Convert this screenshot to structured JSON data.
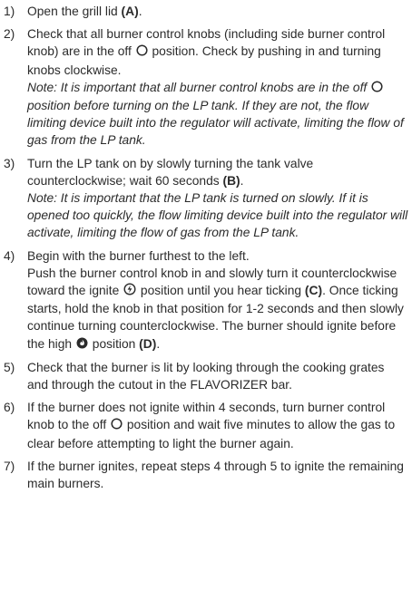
{
  "steps": [
    {
      "num": "1)",
      "text": "Open the grill lid ",
      "ref": "(A)",
      "tail": "."
    },
    {
      "num": "2)",
      "text_a": "Check that all burner control knobs (including side burner control knob) are in the off ",
      "text_b": " position. Check by pushing in and turning knobs clockwise.",
      "note_a": "Note: It is important that all burner control knobs are in the off ",
      "note_b": " position before turning on the LP tank. If they are not, the flow limiting device built into the regulator will activate, limiting the flow of gas from the LP tank."
    },
    {
      "num": "3)",
      "text": "Turn the LP tank on by slowly turning the tank valve counterclockwise; wait 60 seconds ",
      "ref": "(B)",
      "tail": ".",
      "note": "Note: It is important that the LP tank is turned on slowly. If it is opened too quickly, the flow limiting device built into the regulator will activate, limiting the flow of gas from the LP tank."
    },
    {
      "num": "4)",
      "line1": "Begin with the burner furthest to the left.",
      "text_a": "Push the burner control knob in and slowly turn it counterclockwise toward the ignite ",
      "text_b": " position until you hear ticking ",
      "ref_c": "(C)",
      "text_c": ". Once ticking starts, hold the knob in that position for 1-2 seconds and then slowly continue turning counterclockwise. The burner should ignite before the high ",
      "text_d": " position ",
      "ref_d": "(D)",
      "tail": "."
    },
    {
      "num": "5)",
      "text": "Check that the burner is lit by looking through the cooking grates and through the cutout in the FLAVORIZER bar."
    },
    {
      "num": "6)",
      "text_a": "If the burner does not ignite within 4 seconds, turn burner control knob to the off ",
      "text_b": " position and wait five minutes to allow the gas to clear before attempting to light the burner again."
    },
    {
      "num": "7)",
      "text": "If the burner ignites, repeat steps 4 through 5 to ignite the remaining main burners."
    }
  ],
  "icons": {
    "off": "off-position-circle-icon",
    "ignite": "ignite-position-icon",
    "high": "high-flame-position-icon"
  }
}
